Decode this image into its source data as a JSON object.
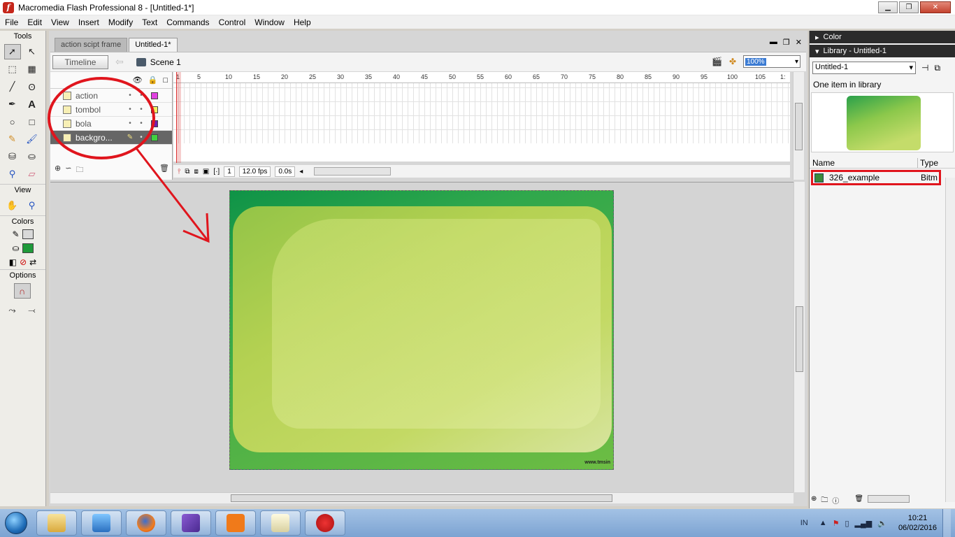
{
  "window": {
    "title": "Macromedia Flash Professional 8 - [Untitled-1*]",
    "icon": "flash-icon"
  },
  "menu": [
    "File",
    "Edit",
    "View",
    "Insert",
    "Modify",
    "Text",
    "Commands",
    "Control",
    "Window",
    "Help"
  ],
  "tools": {
    "title": "Tools",
    "view_label": "View",
    "colors_label": "Colors",
    "options_label": "Options",
    "stroke_color": "#d9d9d9",
    "fill_color": "#1f9a3a"
  },
  "doc_tabs": [
    {
      "label": "action scipt frame"
    },
    {
      "label": "Untitled-1*"
    }
  ],
  "timeline": {
    "button_label": "Timeline",
    "scene_label": "Scene 1",
    "zoom": "100%",
    "ruler": [
      "1",
      "5",
      "10",
      "15",
      "20",
      "25",
      "30",
      "35",
      "40",
      "45",
      "50",
      "55",
      "60",
      "65",
      "70",
      "75",
      "80",
      "85",
      "90",
      "95",
      "100",
      "105",
      "1:"
    ],
    "layers": [
      {
        "name": "action",
        "color": "#e040e0"
      },
      {
        "name": "tombol",
        "color": "#f0f060"
      },
      {
        "name": "bola",
        "color": "#7020b0"
      },
      {
        "name": "backgro...",
        "color": "#40d040"
      }
    ],
    "current_frame": "1",
    "fps": "12.0 fps",
    "time": "0.0s"
  },
  "stage": {
    "watermark": "www.tmsin"
  },
  "panels": {
    "color_title": "Color",
    "library_title": "Library - Untitled-1",
    "library_select": "Untitled-1",
    "item_count": "One item in library",
    "col_name": "Name",
    "col_type": "Type",
    "items": [
      {
        "name": "326_example",
        "type": "Bitm"
      }
    ]
  },
  "taskbar": {
    "lang": "IN",
    "time": "10:21",
    "date": "06/02/2016"
  },
  "annotation_color": "#e0151d"
}
